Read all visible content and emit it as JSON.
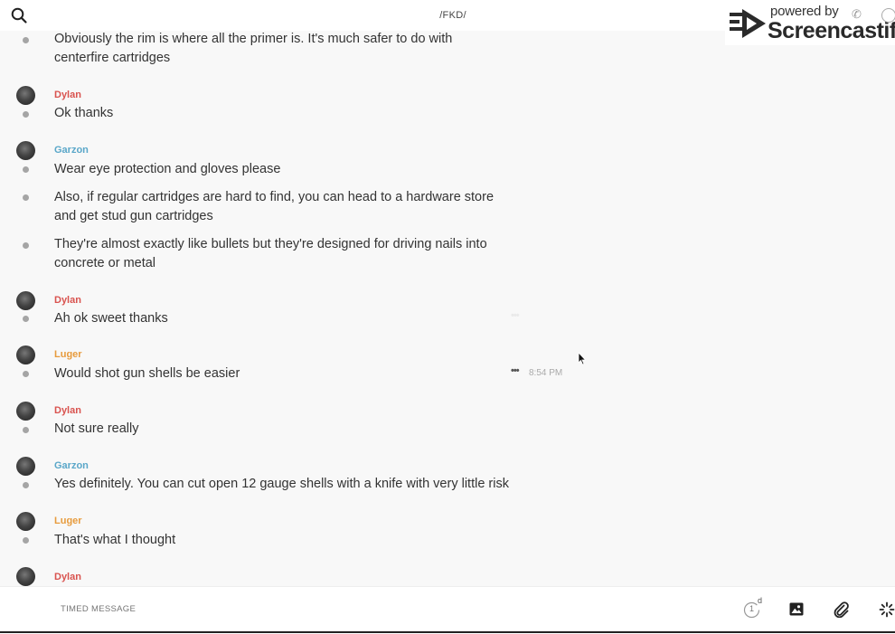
{
  "header": {
    "channel_title": "/FKD/",
    "search_icon": "search-icon"
  },
  "watermark": {
    "powered_by": "powered by",
    "brand": "Screencastify"
  },
  "messages": [
    {
      "lines": [
        "Obviously the rim is where all the primer is. It's much safer to do with",
        "centerfire cartridges"
      ]
    },
    {
      "author": "Dylan",
      "color": "#d9534f",
      "lines": [
        "Ok thanks"
      ]
    },
    {
      "author": "Garzon",
      "color": "#5aa7c9",
      "lines": [
        "Wear eye protection and gloves please"
      ]
    },
    {
      "lines": [
        "Also, if regular cartridges are hard to find, you can head to a hardware store",
        "and get stud gun cartridges"
      ]
    },
    {
      "lines": [
        "They're almost exactly like bullets but they're designed for driving nails into",
        "concrete or metal"
      ]
    },
    {
      "author": "Dylan",
      "color": "#d9534f",
      "lines": [
        "Ah ok sweet thanks"
      ]
    },
    {
      "author": "Luger",
      "color": "#e79b3d",
      "lines": [
        "Would shot gun shells be easier"
      ],
      "time": "8:54 PM"
    },
    {
      "author": "Dylan",
      "color": "#d9534f",
      "lines": [
        "Not sure really"
      ]
    },
    {
      "author": "Garzon",
      "color": "#5aa7c9",
      "lines": [
        "Yes definitely. You can cut open 12 gauge shells with a knife with very little risk"
      ]
    },
    {
      "author": "Luger",
      "color": "#e79b3d",
      "lines": [
        "That's what I thought"
      ]
    },
    {
      "author": "Dylan",
      "color": "#d9534f",
      "lines": []
    }
  ],
  "composer": {
    "placeholder": "TIMED MESSAGE",
    "timer_value": "1",
    "timer_unit": "d"
  }
}
